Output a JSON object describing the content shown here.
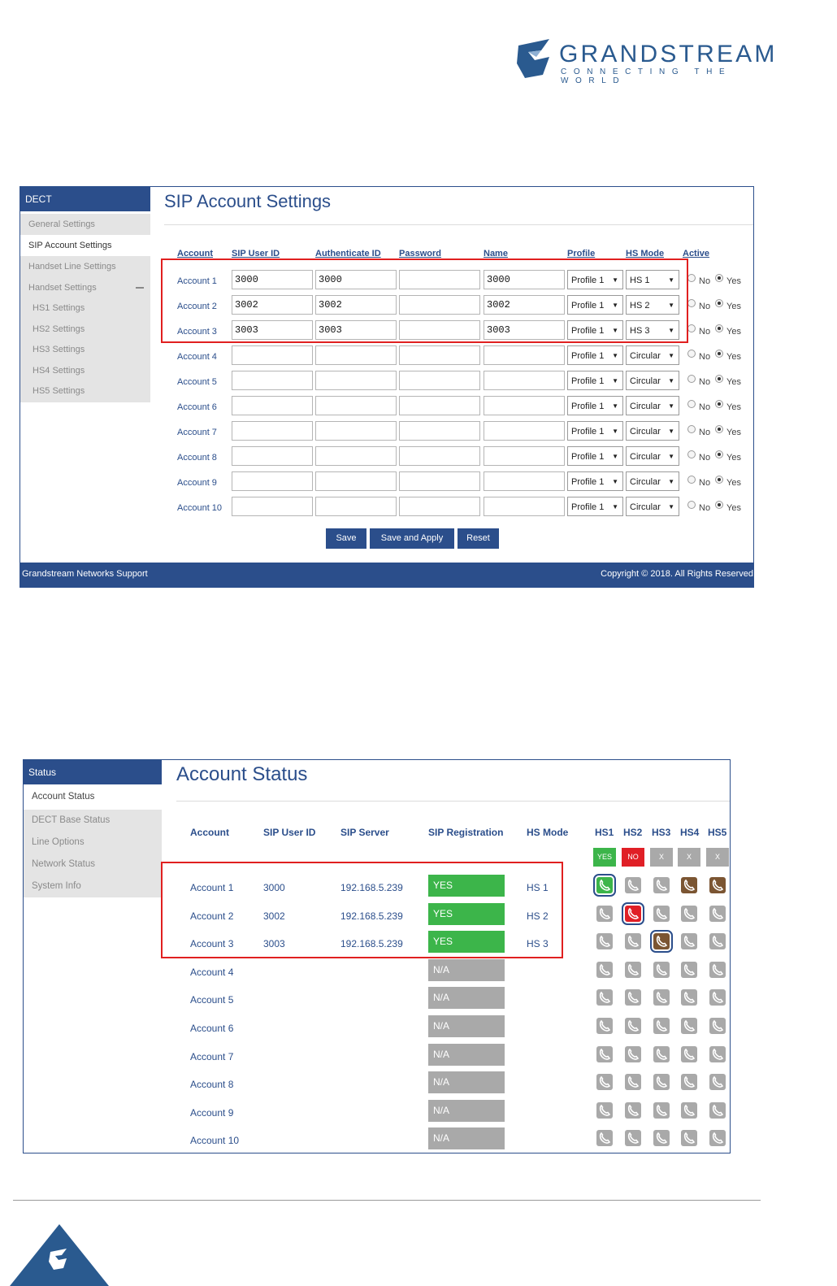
{
  "logo": {
    "name": "GRANDSTREAM",
    "tagline": "CONNECTING THE WORLD"
  },
  "colors": {
    "brand": "#2b4e8b",
    "yes": "#3cb54a",
    "no": "#e01f26",
    "na": "#a9a9a9",
    "highlight": "#e02020"
  },
  "sip_settings": {
    "sidebar": {
      "header": "DECT",
      "items": [
        "General Settings",
        "SIP Account Settings",
        "Handset Line Settings",
        "Handset Settings",
        "HS1 Settings",
        "HS2 Settings",
        "HS3 Settings",
        "HS4 Settings",
        "HS5 Settings"
      ]
    },
    "title": "SIP Account Settings",
    "headers": {
      "account": "Account",
      "sip_user_id": "SIP User ID",
      "auth_id": "Authenticate ID",
      "password": "Password",
      "name": "Name",
      "profile": "Profile",
      "hs_mode": "HS Mode",
      "active": "Active"
    },
    "rows": [
      {
        "account": "Account 1",
        "sip_user_id": "3000",
        "auth_id": "3000",
        "password": "",
        "name": "3000",
        "profile": "Profile 1",
        "hs_mode": "HS 1",
        "active": "Yes"
      },
      {
        "account": "Account 2",
        "sip_user_id": "3002",
        "auth_id": "3002",
        "password": "",
        "name": "3002",
        "profile": "Profile 1",
        "hs_mode": "HS 2",
        "active": "Yes"
      },
      {
        "account": "Account 3",
        "sip_user_id": "3003",
        "auth_id": "3003",
        "password": "",
        "name": "3003",
        "profile": "Profile 1",
        "hs_mode": "HS 3",
        "active": "Yes"
      },
      {
        "account": "Account 4",
        "sip_user_id": "",
        "auth_id": "",
        "password": "",
        "name": "",
        "profile": "Profile 1",
        "hs_mode": "Circular",
        "active": "Yes"
      },
      {
        "account": "Account 5",
        "sip_user_id": "",
        "auth_id": "",
        "password": "",
        "name": "",
        "profile": "Profile 1",
        "hs_mode": "Circular",
        "active": "Yes"
      },
      {
        "account": "Account 6",
        "sip_user_id": "",
        "auth_id": "",
        "password": "",
        "name": "",
        "profile": "Profile 1",
        "hs_mode": "Circular",
        "active": "Yes"
      },
      {
        "account": "Account 7",
        "sip_user_id": "",
        "auth_id": "",
        "password": "",
        "name": "",
        "profile": "Profile 1",
        "hs_mode": "Circular",
        "active": "Yes"
      },
      {
        "account": "Account 8",
        "sip_user_id": "",
        "auth_id": "",
        "password": "",
        "name": "",
        "profile": "Profile 1",
        "hs_mode": "Circular",
        "active": "Yes"
      },
      {
        "account": "Account 9",
        "sip_user_id": "",
        "auth_id": "",
        "password": "",
        "name": "",
        "profile": "Profile 1",
        "hs_mode": "Circular",
        "active": "Yes"
      },
      {
        "account": "Account 10",
        "sip_user_id": "",
        "auth_id": "",
        "password": "",
        "name": "",
        "profile": "Profile 1",
        "hs_mode": "Circular",
        "active": "Yes"
      }
    ],
    "radio_labels": {
      "no": "No",
      "yes": "Yes"
    },
    "buttons": {
      "save": "Save",
      "save_apply": "Save and Apply",
      "reset": "Reset"
    },
    "footer": {
      "left": "Grandstream Networks Support",
      "right": "Copyright © 2018. All Rights Reserved"
    }
  },
  "account_status": {
    "sidebar": {
      "header": "Status",
      "items": [
        "Account Status",
        "DECT Base Status",
        "Line Options",
        "Network Status",
        "System Info"
      ]
    },
    "title": "Account Status",
    "headers": {
      "account": "Account",
      "sip_user_id": "SIP User ID",
      "sip_server": "SIP Server",
      "sip_registration": "SIP Registration",
      "hs_mode": "HS Mode",
      "hs": [
        "HS1",
        "HS2",
        "HS3",
        "HS4",
        "HS5"
      ]
    },
    "hs_status": [
      {
        "label": "YES",
        "state": "yes"
      },
      {
        "label": "NO",
        "state": "no"
      },
      {
        "label": "X",
        "state": "off"
      },
      {
        "label": "X",
        "state": "off"
      },
      {
        "label": "X",
        "state": "off"
      }
    ],
    "rows": [
      {
        "account": "Account 1",
        "sip_user_id": "3000",
        "sip_server": "192.168.5.239",
        "registration": "YES",
        "hs_mode": "HS 1",
        "icons": [
          "green-sel",
          "gray",
          "gray",
          "brown",
          "brown"
        ]
      },
      {
        "account": "Account 2",
        "sip_user_id": "3002",
        "sip_server": "192.168.5.239",
        "registration": "YES",
        "hs_mode": "HS 2",
        "icons": [
          "gray",
          "red-sel",
          "gray",
          "gray",
          "gray"
        ]
      },
      {
        "account": "Account 3",
        "sip_user_id": "3003",
        "sip_server": "192.168.5.239",
        "registration": "YES",
        "hs_mode": "HS 3",
        "icons": [
          "gray",
          "gray",
          "brown-sel",
          "gray",
          "gray"
        ]
      },
      {
        "account": "Account 4",
        "sip_user_id": "",
        "sip_server": "",
        "registration": "N/A",
        "hs_mode": "",
        "icons": [
          "gray",
          "gray",
          "gray",
          "gray",
          "gray"
        ]
      },
      {
        "account": "Account 5",
        "sip_user_id": "",
        "sip_server": "",
        "registration": "N/A",
        "hs_mode": "",
        "icons": [
          "gray",
          "gray",
          "gray",
          "gray",
          "gray"
        ]
      },
      {
        "account": "Account 6",
        "sip_user_id": "",
        "sip_server": "",
        "registration": "N/A",
        "hs_mode": "",
        "icons": [
          "gray",
          "gray",
          "gray",
          "gray",
          "gray"
        ]
      },
      {
        "account": "Account 7",
        "sip_user_id": "",
        "sip_server": "",
        "registration": "N/A",
        "hs_mode": "",
        "icons": [
          "gray",
          "gray",
          "gray",
          "gray",
          "gray"
        ]
      },
      {
        "account": "Account 8",
        "sip_user_id": "",
        "sip_server": "",
        "registration": "N/A",
        "hs_mode": "",
        "icons": [
          "gray",
          "gray",
          "gray",
          "gray",
          "gray"
        ]
      },
      {
        "account": "Account 9",
        "sip_user_id": "",
        "sip_server": "",
        "registration": "N/A",
        "hs_mode": "",
        "icons": [
          "gray",
          "gray",
          "gray",
          "gray",
          "gray"
        ]
      },
      {
        "account": "Account 10",
        "sip_user_id": "",
        "sip_server": "",
        "registration": "N/A",
        "hs_mode": "",
        "icons": [
          "gray",
          "gray",
          "gray",
          "gray",
          "gray"
        ]
      }
    ]
  }
}
